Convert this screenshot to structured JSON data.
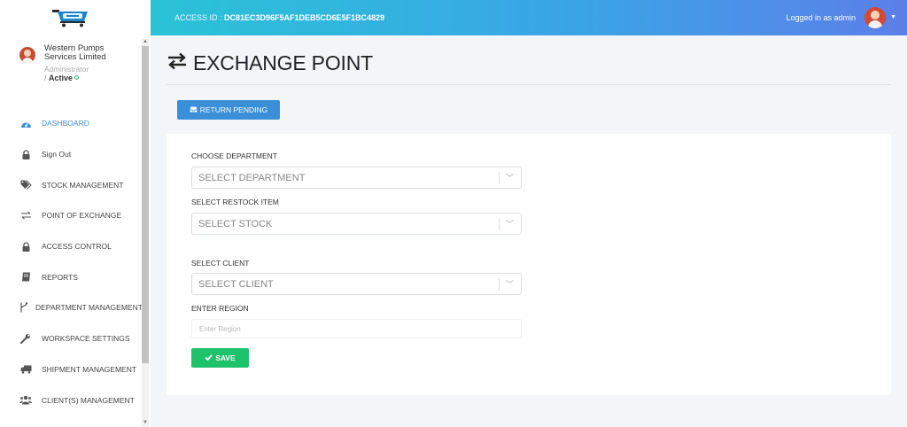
{
  "topbar": {
    "access_prefix": "ACCESS ID : ",
    "access_id": "DC81EC3D96F5AF1DEB5CD6E5F1BC4829",
    "logged_in": "Logged in as admin"
  },
  "sidebar": {
    "user": {
      "org": "Western Pumps Services Limited",
      "role": "Administrator",
      "status_prefix": "/ ",
      "status": "Active"
    },
    "items": [
      {
        "label": "DASHBOARD",
        "icon": "dashboard-icon"
      },
      {
        "label": "Sign Out",
        "icon": "lock-icon"
      },
      {
        "label": "STOCK MANAGEMENT",
        "icon": "tags-icon"
      },
      {
        "label": "POINT OF EXCHANGE",
        "icon": "exchange-icon"
      },
      {
        "label": "ACCESS CONTROL",
        "icon": "lock-icon"
      },
      {
        "label": "REPORTS",
        "icon": "book-icon"
      },
      {
        "label": "DEPARTMENT MANAGEMENT",
        "icon": "branch-icon"
      },
      {
        "label": "WORKSPACE SETTINGS",
        "icon": "wrench-icon"
      },
      {
        "label": "SHIPMENT MANAGEMENT",
        "icon": "truck-icon"
      },
      {
        "label": "CLIENT(S) MANAGEMENT",
        "icon": "users-icon"
      }
    ]
  },
  "main": {
    "title": "EXCHANGE POINT",
    "return_button": "RETURN PENDING",
    "form": {
      "department_label": "CHOOSE DEPARTMENT",
      "department_value": "SELECT DEPARTMENT",
      "restock_label": "SELECT RESTOCK ITEM",
      "restock_value": "SELECT STOCK",
      "client_label": "SELECT CLIENT",
      "client_value": "SELECT CLIENT",
      "region_label": "ENTER REGION",
      "region_placeholder": "Enter Region",
      "save_button": "SAVE"
    }
  },
  "colors": {
    "accent": "#3a8fd8",
    "save": "#1ec26a",
    "topbar_start": "#2ac3d6",
    "topbar_end": "#5b7fe8"
  }
}
